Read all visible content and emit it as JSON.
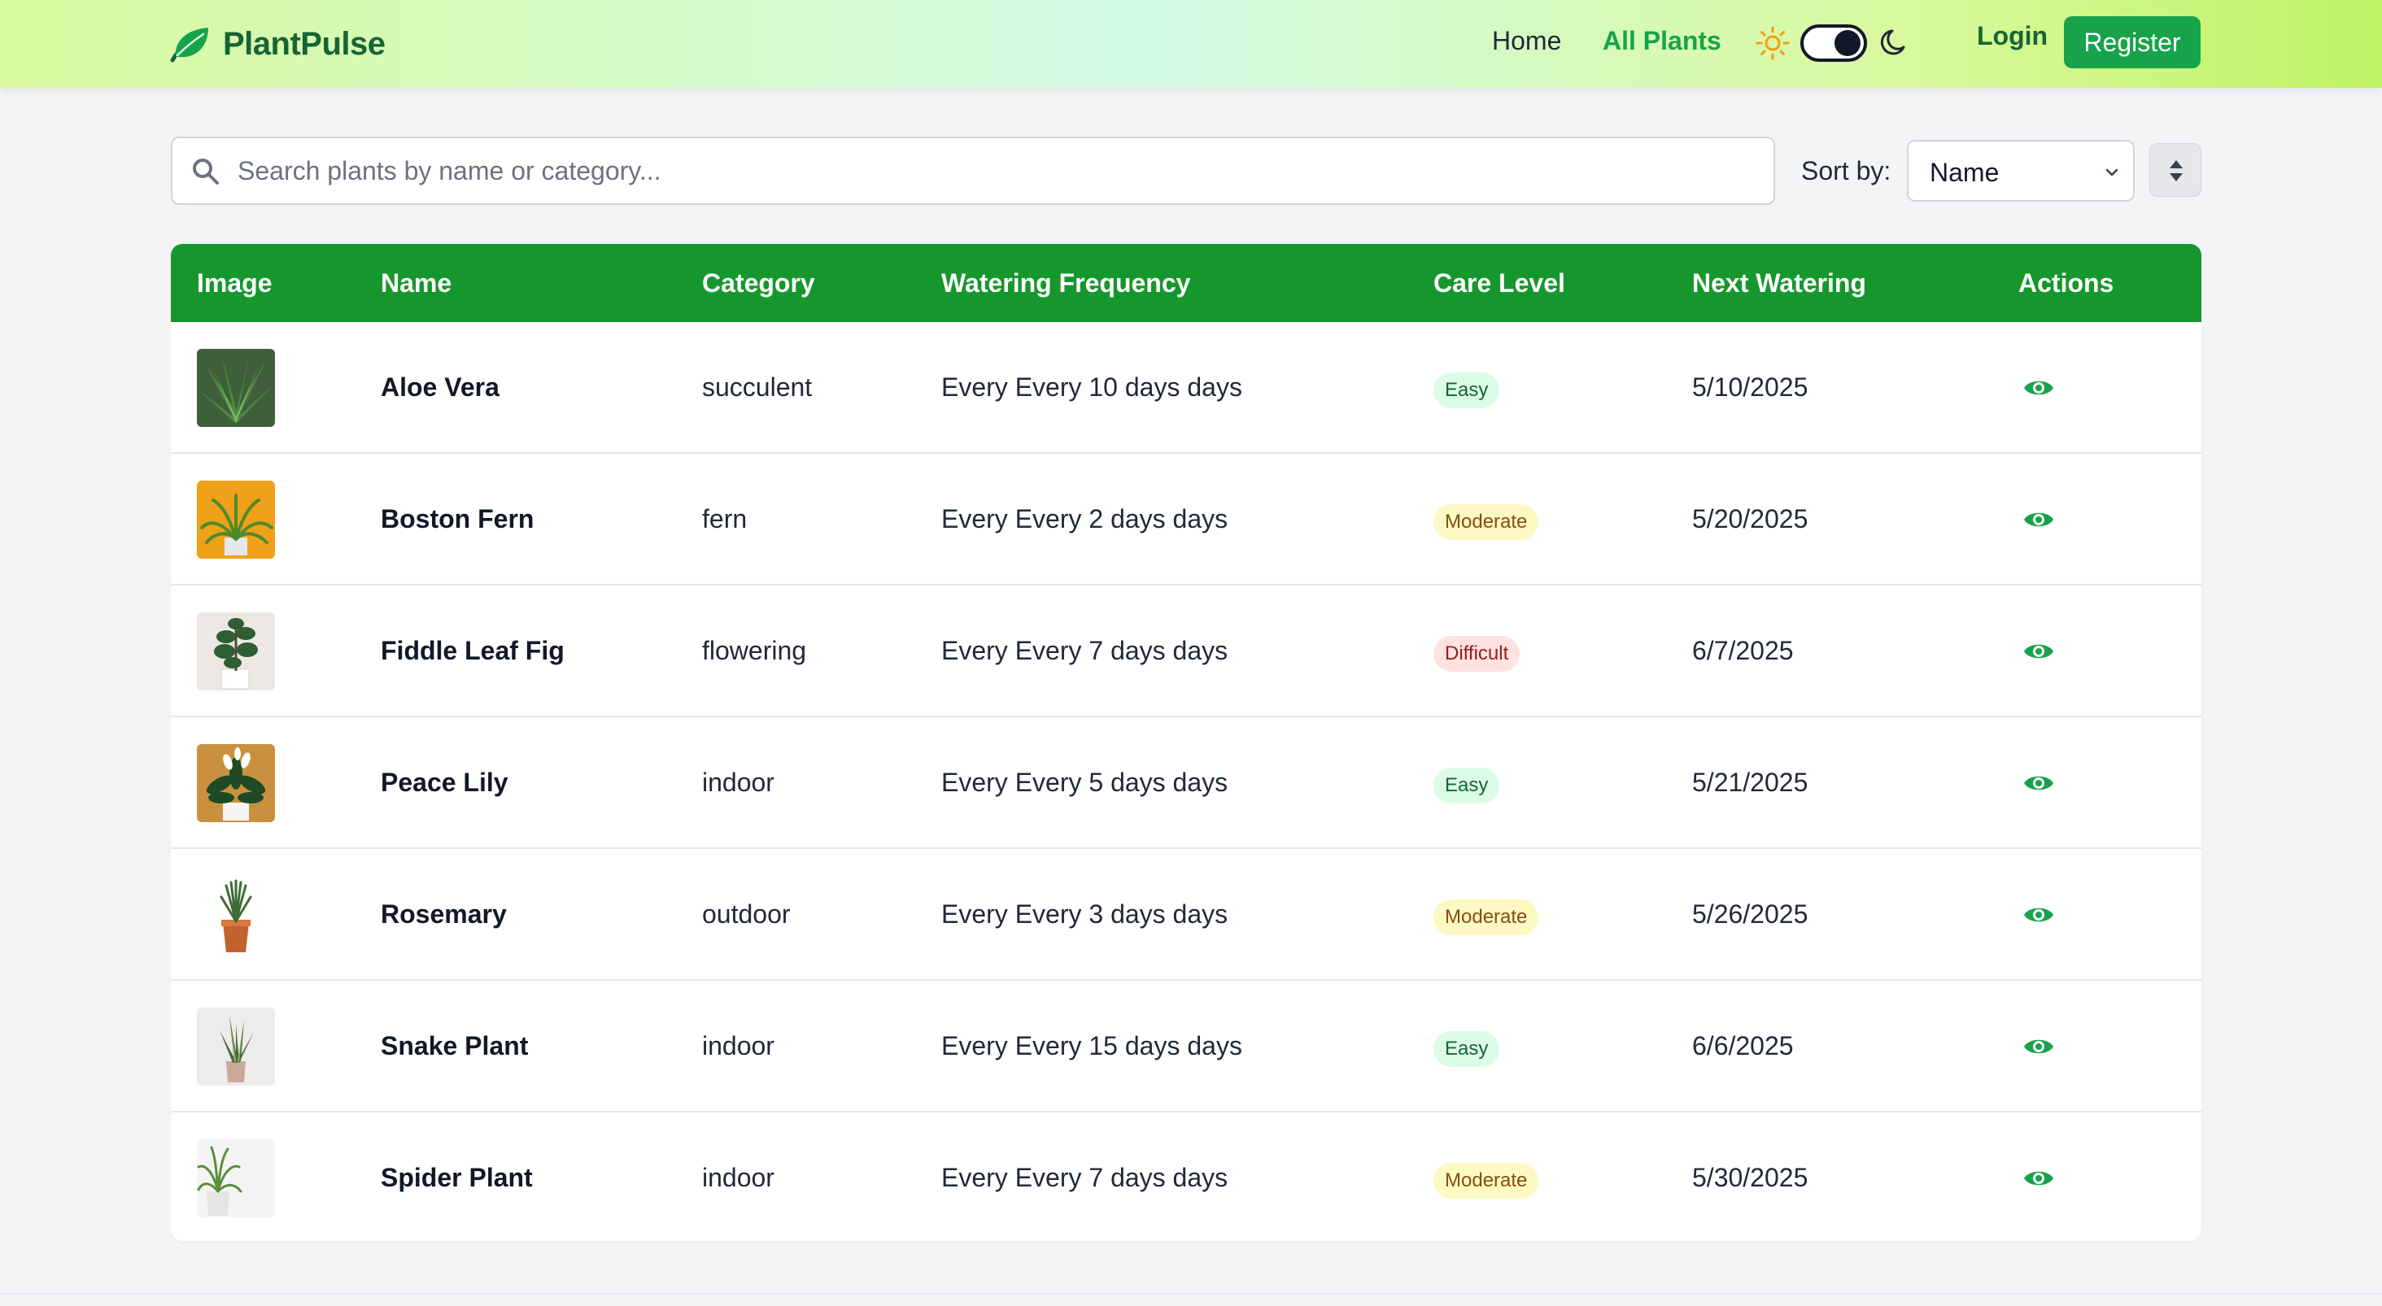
{
  "brand": {
    "name": "PlantPulse",
    "icon": "leaf-icon"
  },
  "nav": {
    "home": "Home",
    "all_plants": "All Plants",
    "login": "Login",
    "register": "Register",
    "theme_toggle": {
      "state": "dark",
      "icons": [
        "sun-icon",
        "moon-icon"
      ]
    }
  },
  "search": {
    "placeholder": "Search plants by name or category...",
    "value": ""
  },
  "sort": {
    "label": "Sort by:",
    "selected": "Name",
    "direction_icon": "sort-icon"
  },
  "table": {
    "headers": [
      "Image",
      "Name",
      "Category",
      "Watering Frequency",
      "Care Level",
      "Next Watering",
      "Actions"
    ],
    "rows": [
      {
        "name": "Aloe Vera",
        "category": "succulent",
        "watering": "Every Every 10 days days",
        "care": "Easy",
        "next": "5/10/2025"
      },
      {
        "name": "Boston Fern",
        "category": "fern",
        "watering": "Every Every 2 days days",
        "care": "Moderate",
        "next": "5/20/2025"
      },
      {
        "name": "Fiddle Leaf Fig",
        "category": "flowering",
        "watering": "Every Every 7 days days",
        "care": "Difficult",
        "next": "6/7/2025"
      },
      {
        "name": "Peace Lily",
        "category": "indoor",
        "watering": "Every Every 5 days days",
        "care": "Easy",
        "next": "5/21/2025"
      },
      {
        "name": "Rosemary",
        "category": "outdoor",
        "watering": "Every Every 3 days days",
        "care": "Moderate",
        "next": "5/26/2025"
      },
      {
        "name": "Snake Plant",
        "category": "indoor",
        "watering": "Every Every 15 days days",
        "care": "Easy",
        "next": "6/6/2025"
      },
      {
        "name": "Spider Plant",
        "category": "indoor",
        "watering": "Every Every 7 days days",
        "care": "Moderate",
        "next": "5/30/2025"
      }
    ]
  },
  "colors": {
    "brand_green": "#166534",
    "accent_green": "#16a34a",
    "header_green": "#16972d"
  }
}
